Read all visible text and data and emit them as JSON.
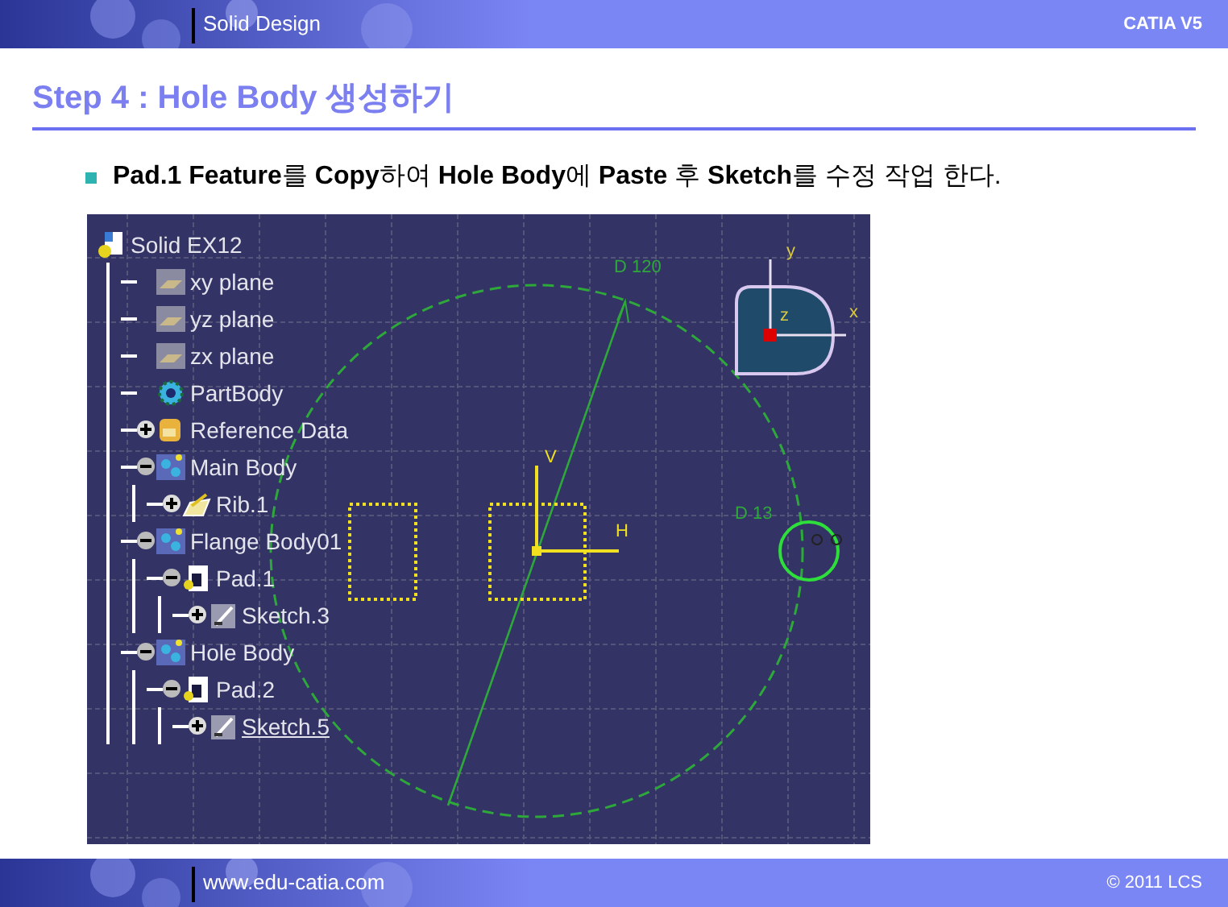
{
  "header": {
    "section": "Solid Design",
    "product": "CATIA V5"
  },
  "title": "Step 4 : Hole Body 생성하기",
  "bullet": "**Pad.1 Feature**를 **Copy**하여 **Hole Body**에 **Paste** 후 **Sketch**를 수정 작업 한다.",
  "tree": {
    "label": "Solid EX12",
    "kind": "document",
    "current": false,
    "children": [
      {
        "label": "xy plane",
        "kind": "plane",
        "current": false
      },
      {
        "label": "yz plane",
        "kind": "plane",
        "current": false
      },
      {
        "label": "zx plane",
        "kind": "plane",
        "current": false
      },
      {
        "label": "PartBody",
        "kind": "gear",
        "current": false
      },
      {
        "label": "Reference Data",
        "kind": "reference",
        "expanded": false,
        "current": false
      },
      {
        "label": "Main Body",
        "kind": "body",
        "expanded": true,
        "current": false,
        "children": [
          {
            "label": "Rib.1",
            "kind": "rib",
            "expanded": false,
            "current": false
          }
        ]
      },
      {
        "label": "Flange Body01",
        "kind": "body",
        "expanded": true,
        "current": false,
        "children": [
          {
            "label": "Pad.1",
            "kind": "pad",
            "expanded": true,
            "current": false,
            "children": [
              {
                "label": "Sketch.3",
                "kind": "sketch",
                "expanded": false,
                "current": false
              }
            ]
          }
        ]
      },
      {
        "label": "Hole Body",
        "kind": "body",
        "expanded": true,
        "current": false,
        "children": [
          {
            "label": "Pad.2",
            "kind": "pad",
            "expanded": true,
            "current": false,
            "children": [
              {
                "label": "Sketch.5",
                "kind": "sketch",
                "expanded": false,
                "current": true
              }
            ]
          }
        ]
      }
    ]
  },
  "sketch": {
    "big_diameter": "D 120",
    "small_diameter": "D 13",
    "h_axis": "H",
    "v_axis": "V",
    "compass": {
      "x": "x",
      "y": "y",
      "z": "z"
    }
  },
  "footer": {
    "url": "www.edu-catia.com",
    "copyright": "© 2011 LCS"
  }
}
